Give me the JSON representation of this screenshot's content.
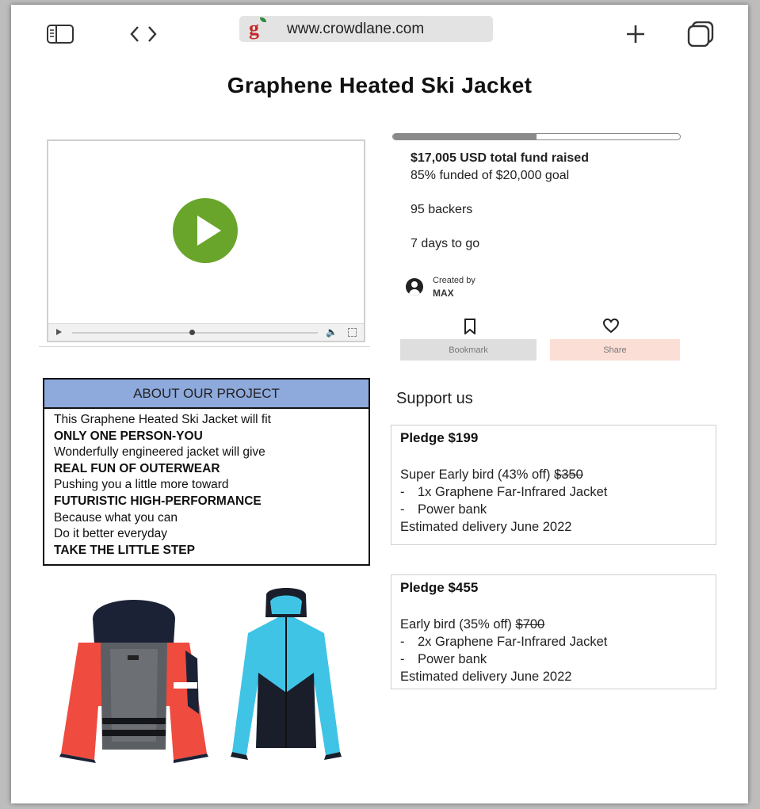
{
  "browser": {
    "url": "www.crowdlane.com",
    "site_logo_letter": "g"
  },
  "page": {
    "title": "Graphene Heated Ski Jacket"
  },
  "funding": {
    "progress_fraction": 0.5,
    "total_raised": "$17,005 USD total fund raised",
    "funded_text": "85% funded of $20,000 goal",
    "backers": "95 backers",
    "days_left": "7 days to go",
    "created_by_label": "Created by",
    "creator": "MAX"
  },
  "actions": {
    "bookmark_label": "Bookmark",
    "share_label": "Share"
  },
  "about": {
    "heading": "ABOUT OUR PROJECT",
    "lines": [
      {
        "text": "This Graphene Heated Ski Jacket will fit",
        "bold": false
      },
      {
        "text": "ONLY ONE PERSON-YOU",
        "bold": true
      },
      {
        "text": "Wonderfully engineered jacket will give",
        "bold": false
      },
      {
        "text": "REAL FUN OF OUTERWEAR",
        "bold": true
      },
      {
        "text": "Pushing you a little more toward",
        "bold": false
      },
      {
        "text": "FUTURISTIC HIGH-PERFORMANCE",
        "bold": true
      },
      {
        "text": "Because what you can",
        "bold": false
      },
      {
        "text": "Do it better everyday",
        "bold": false
      },
      {
        "text": "TAKE THE LITTLE STEP",
        "bold": true
      }
    ]
  },
  "support": {
    "heading": "Support us",
    "pledges": [
      {
        "title": "Pledge $199",
        "tier": "Super Early bird (43% off)",
        "original_price": "$350",
        "items": [
          "1x Graphene Far-Infrared Jacket",
          "Power bank"
        ],
        "delivery": "Estimated delivery June 2022"
      },
      {
        "title": "Pledge $455",
        "tier": "Early bird (35% off)",
        "original_price": "$700",
        "items": [
          "2x Graphene Far-Infrared Jacket",
          "Power bank"
        ],
        "delivery": "Estimated delivery June 2022"
      }
    ]
  },
  "colors": {
    "play_button": "#6aa52b",
    "about_header": "#8ea9db",
    "share_button": "#fbdfd6",
    "bookmark_button": "#dedede",
    "logo": "#c62828"
  }
}
